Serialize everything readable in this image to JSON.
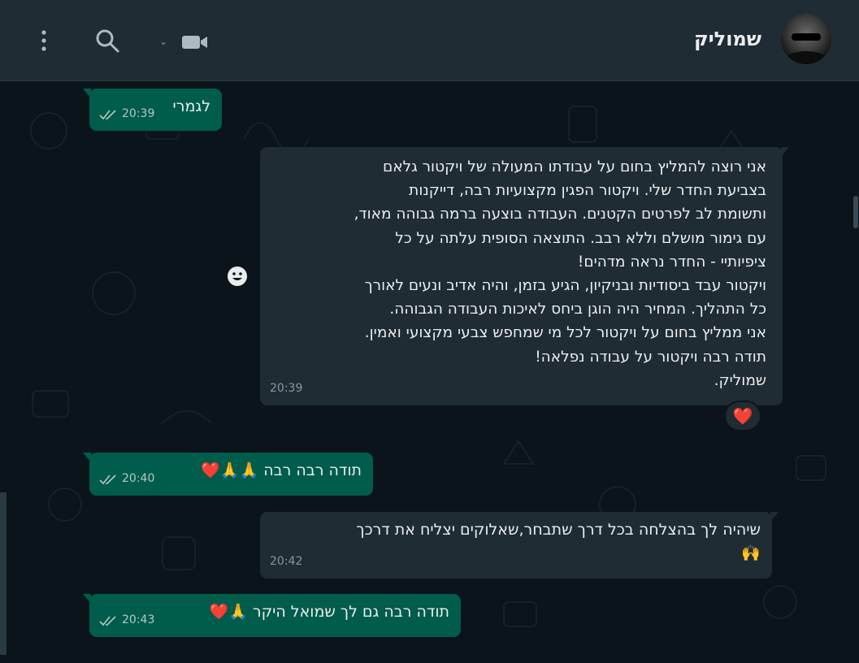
{
  "header": {
    "contact_name": "שמוליק",
    "icons": [
      "avatar",
      "video-call-icon",
      "chevron-down-icon",
      "search-icon",
      "menu-dots-icon"
    ]
  },
  "messages": [
    {
      "direction": "outgoing",
      "text": "לגמרי",
      "time": "20:39",
      "status": "read"
    },
    {
      "direction": "incoming",
      "text": "אני רוצה להמליץ בחום על עבודתו המעולה של ויקטור גלאם\nבצביעת החדר שלי. ויקטור הפגין מקצועיות רבה, דייקנות\nותשומת לב לפרטים הקטנים. העבודה בוצעה ברמה גבוהה מאוד,\nעם גימור מושלם וללא רבב. התוצאה הסופית עלתה על כל\nציפיותיי - החדר נראה מדהים!\nויקטור עבד ביסודיות ובניקיון, הגיע בזמן, והיה אדיב ונעים לאורך\nכל התהליך. המחיר היה הוגן ביחס לאיכות העבודה הגבוהה.\nאני ממליץ בחום על ויקטור לכל מי שמחפש צבעי מקצועי ואמין.\nתודה רבה ויקטור על עבודה נפלאה!\nשמוליק.",
      "time": "20:39",
      "reaction": "❤️"
    },
    {
      "direction": "outgoing",
      "text": "תודה רבה רבה 🙏🙏❤️",
      "time": "20:40",
      "status": "read"
    },
    {
      "direction": "incoming",
      "text": "שיהיה לך בהצלחה בכל דרך שתבחר,שאלוקים יצליח את דרכך\n🙌",
      "time": "20:42"
    },
    {
      "direction": "outgoing",
      "text": "תודה רבה גם לך שמואל היקר 🙏❤️",
      "time": "20:43",
      "status": "read"
    }
  ],
  "colors": {
    "background": "#0b141a",
    "header": "#202c33",
    "outgoing_bubble": "#005c4b",
    "incoming_bubble": "#202c33",
    "read_ticks": "#b7c8c2"
  }
}
